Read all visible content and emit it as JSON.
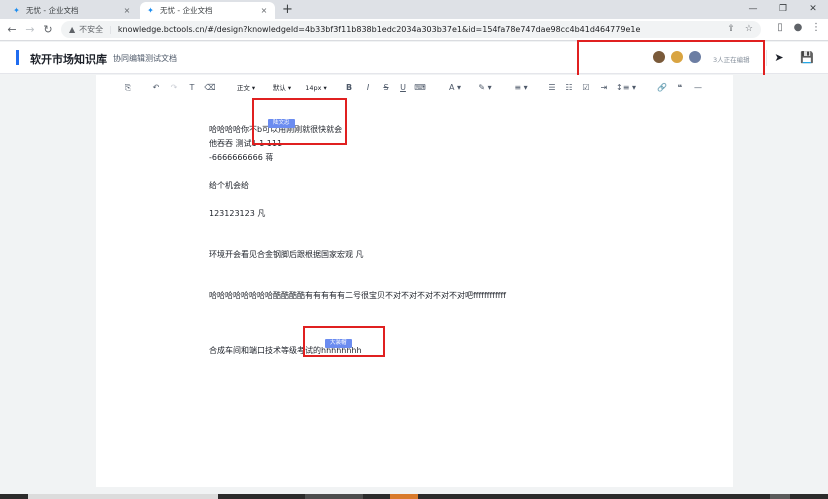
{
  "browser": {
    "tabs": [
      {
        "title": "无忧 - 企业文档",
        "active": false
      },
      {
        "title": "无忧 - 企业文档",
        "active": true
      }
    ],
    "new_tab_symbol": "+",
    "close_symbol": "×",
    "insecure_label": "不安全",
    "url": "knowledge.bctools.cn/#/design?knowledgeId=4b33bf3f11b838b1edc2034a303b37e1&id=154fa78e747dae98cc4b41d464779e1e"
  },
  "app": {
    "brand": "软开市场知识库",
    "doc_title": "协同编辑测试文档",
    "editing_status": "3人正在编辑",
    "avatar_colors": [
      "#7a5a3a",
      "#d9a441",
      "#6c7ea3"
    ]
  },
  "format_toolbar": {
    "paragraph_style": "正文",
    "font_family": "默认",
    "font_size": "14px",
    "bold": "B",
    "italic": "I",
    "strike": "S",
    "underline": "U",
    "font_color": "A",
    "quote": "❝",
    "hr": "—"
  },
  "collaborators": [
    {
      "name": "陆文忠",
      "color": "#6b8cf0"
    },
    {
      "name": "大装帽",
      "color": "#6b8cf0"
    }
  ],
  "document": {
    "lines": [
      "哈哈哈哈你不b可以用刚刚就很快就会",
      "他吞吞  测试1 1 111",
      "-6666666666 蒋",
      "给个机会给",
      "123123123  凡",
      "环境开会看见合金钢脚后跟根据国家宏观  凡",
      "哈哈哈哈哈哈哈哈酷酷酷酷有有有有有二号很宝贝不对不对不对不对不对吧ffffffffffff",
      "合成车间和端口技术等级考试的hhhhhhhh"
    ]
  },
  "colors": {
    "accent": "#1f6cf0",
    "annotation": "#e02020",
    "cursor_flag": "#6b8cf0"
  }
}
